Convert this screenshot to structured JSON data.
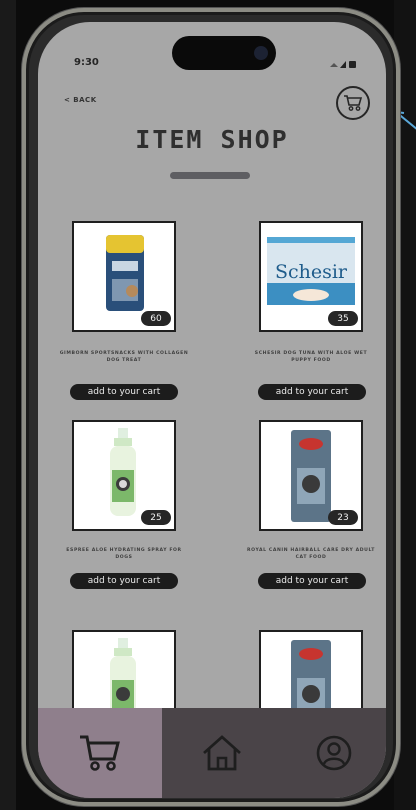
{
  "status": {
    "time": "9:30"
  },
  "header": {
    "back_label": "< BACK",
    "title": "ITEM SHOP"
  },
  "items": [
    {
      "name": "GIMBORN SPORTSNACKS WITH COLLAGEN DOG TREAT",
      "count": "60",
      "button_label": "add to your cart"
    },
    {
      "name": "SCHESIR DOG TUNA WITH ALOE WET PUPPY FOOD",
      "count": "35",
      "button_label": "add to your cart"
    },
    {
      "name": "ESPREE ALOE HYDRATING SPRAY FOR DOGS",
      "count": "25",
      "button_label": "add to your cart"
    },
    {
      "name": "ROYAL CANIN HAIRBALL CARE DRY ADULT CAT FOOD",
      "count": "23",
      "button_label": "add to your cart"
    }
  ],
  "product_images": {
    "brand_text": "Schesir"
  },
  "nav": {
    "items": [
      "cart",
      "home",
      "profile"
    ],
    "active": "cart"
  },
  "colors": {
    "screen_bg": "#a7a7a7",
    "nav_active": "#8f7f8c",
    "nav_bg": "#4a4448",
    "button_bg": "#1c1c1c"
  }
}
